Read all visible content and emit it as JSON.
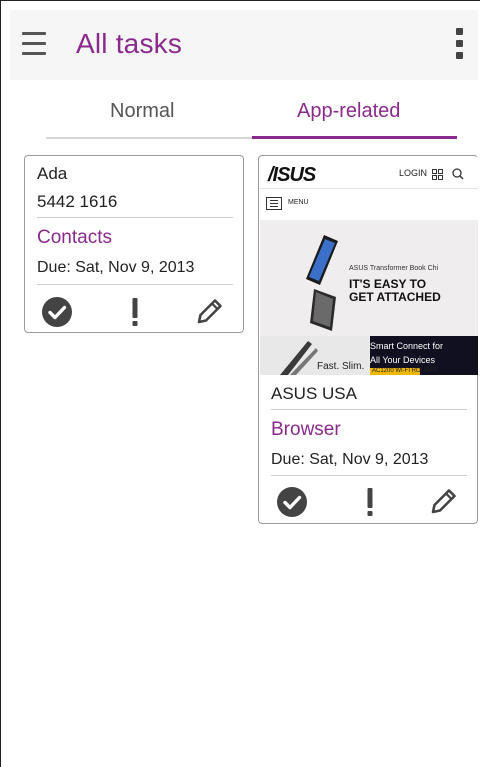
{
  "colors": {
    "accent": "#8b2a8d",
    "appbar_bg": "#f6f6f6",
    "card_border": "#9a9a9a",
    "icon": "#444444"
  },
  "header": {
    "title": "All tasks",
    "menu_icon": "hamburger-icon",
    "more_icon": "more-vert-icon"
  },
  "tabs": [
    {
      "label": "Normal",
      "selected": false
    },
    {
      "label": "App-related",
      "selected": true
    }
  ],
  "cards": [
    {
      "name": "Ada",
      "detail": "5442 1616",
      "app": "Contacts",
      "due": "Due: Sat, Nov 9, 2013",
      "actions": [
        "check-circle-icon",
        "exclamation-icon",
        "pencil-icon"
      ]
    },
    {
      "thumbnail": {
        "logo": "/ISUS",
        "login": "LOGIN",
        "menu": "MENU",
        "product": "ASUS Transformer Book Chi",
        "headline1": "IT'S EASY TO",
        "headline2": "GET ATTACHED",
        "banner_left": "Fast. Slim.",
        "banner_right1": "Smart Connect for",
        "banner_right2": "All Your Devices",
        "banner_tag": "AC1200 WI-FI ROUTER"
      },
      "name": "ASUS USA",
      "app": "Browser",
      "due": "Due: Sat, Nov 9, 2013",
      "actions": [
        "check-circle-icon",
        "exclamation-icon",
        "pencil-icon"
      ]
    }
  ]
}
